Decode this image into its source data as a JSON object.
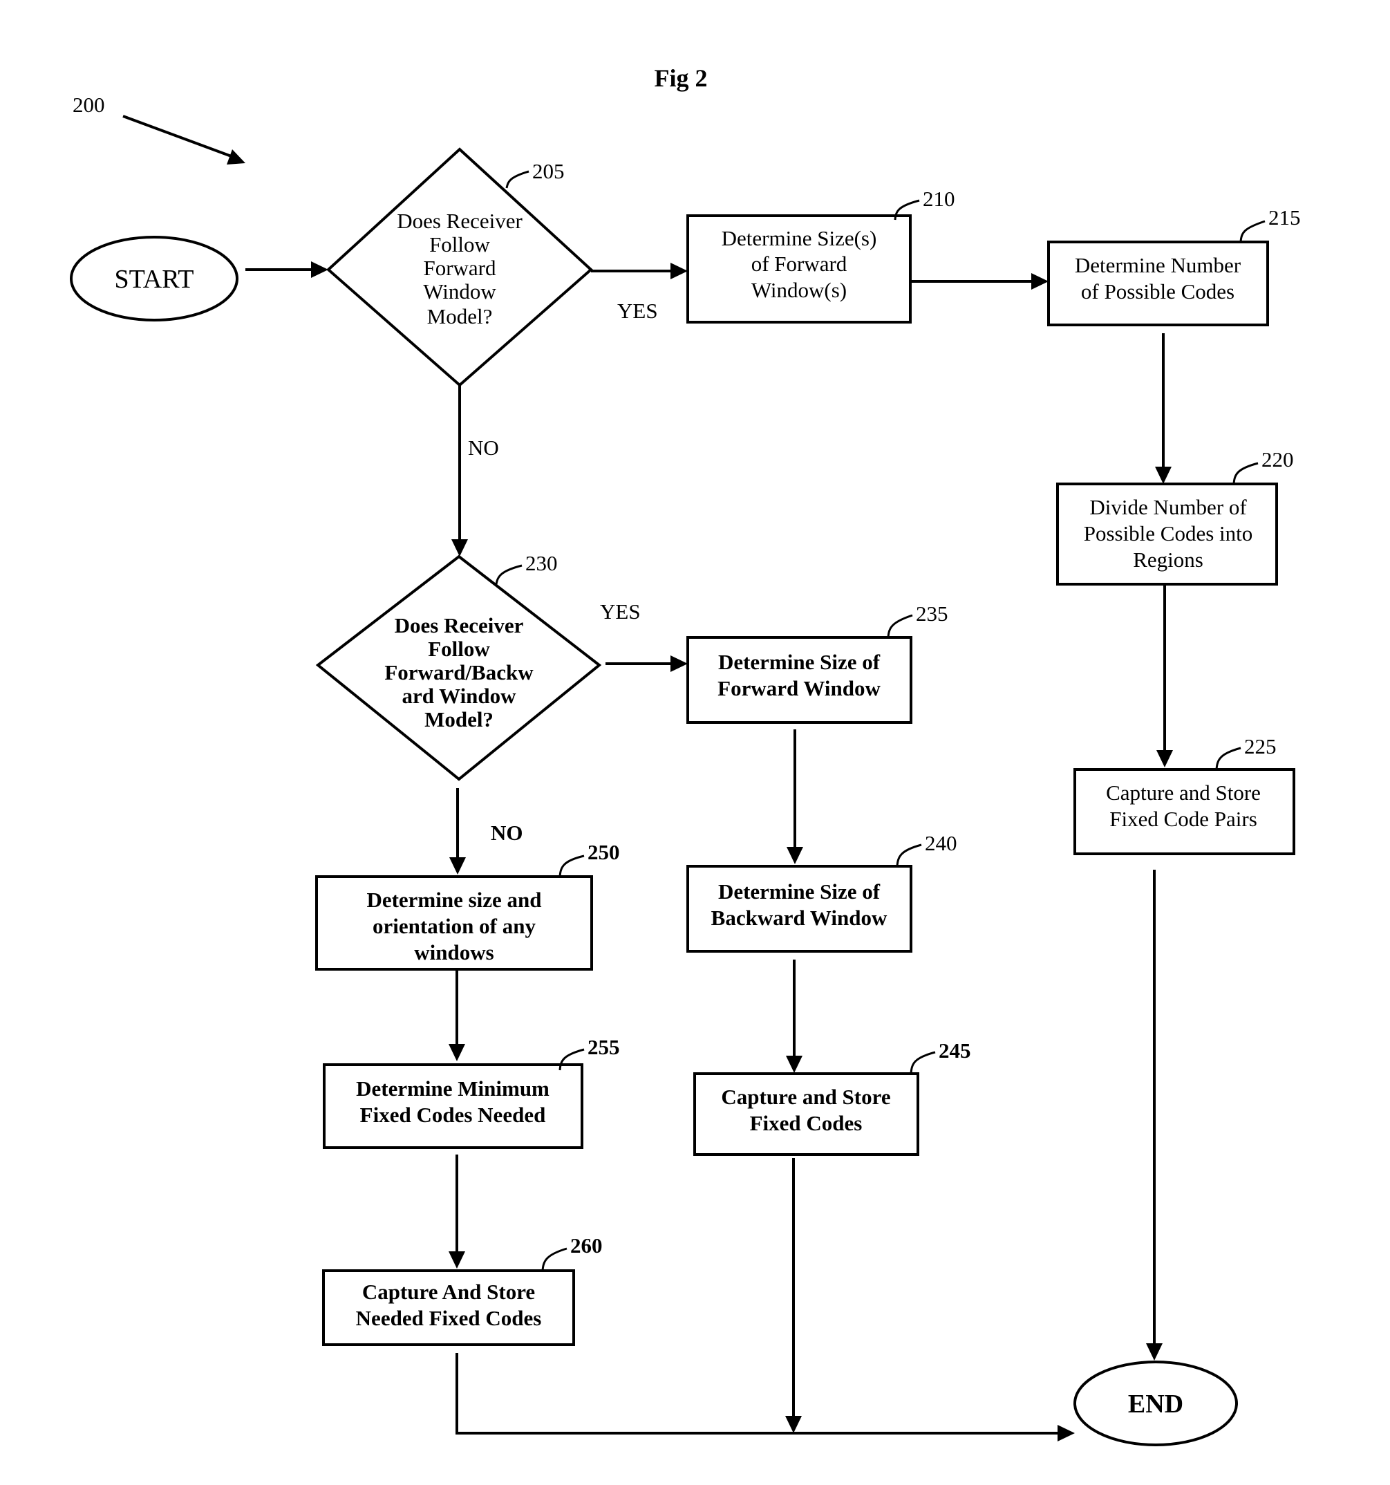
{
  "figure": {
    "title": "Fig 2",
    "reference": "200"
  },
  "nodes": {
    "start": {
      "label": "START"
    },
    "end": {
      "label": "END"
    },
    "n205": {
      "ref": "205",
      "lines": [
        "Does Receiver",
        "Follow",
        "Forward",
        "Window",
        "Model?"
      ]
    },
    "n210": {
      "ref": "210",
      "lines": [
        "Determine Size(s)",
        "of Forward",
        "Window(s)"
      ]
    },
    "n215": {
      "ref": "215",
      "lines": [
        "Determine Number",
        "of Possible Codes"
      ]
    },
    "n220": {
      "ref": "220",
      "lines": [
        "Divide Number of",
        "Possible Codes into",
        "Regions"
      ]
    },
    "n225": {
      "ref": "225",
      "lines": [
        "Capture and Store",
        "Fixed Code Pairs"
      ]
    },
    "n230": {
      "ref": "230",
      "lines": [
        "Does Receiver",
        "Follow",
        "Forward/Backw",
        "ard Window",
        "Model?"
      ]
    },
    "n235": {
      "ref": "235",
      "lines": [
        "Determine Size of",
        "Forward Window"
      ]
    },
    "n240": {
      "ref": "240",
      "lines": [
        "Determine Size of",
        "Backward Window"
      ]
    },
    "n245": {
      "ref": "245",
      "lines": [
        "Capture and Store",
        "Fixed Codes"
      ]
    },
    "n250": {
      "ref": "250",
      "lines": [
        "Determine size and",
        "orientation of any",
        "windows"
      ]
    },
    "n255": {
      "ref": "255",
      "lines": [
        "Determine Minimum",
        "Fixed Codes Needed"
      ]
    },
    "n260": {
      "ref": "260",
      "lines": [
        "Capture And Store",
        "Needed Fixed Codes"
      ]
    }
  },
  "edges": {
    "yes_205": "YES",
    "no_205": "NO",
    "yes_230": "YES",
    "no_230": "NO"
  }
}
